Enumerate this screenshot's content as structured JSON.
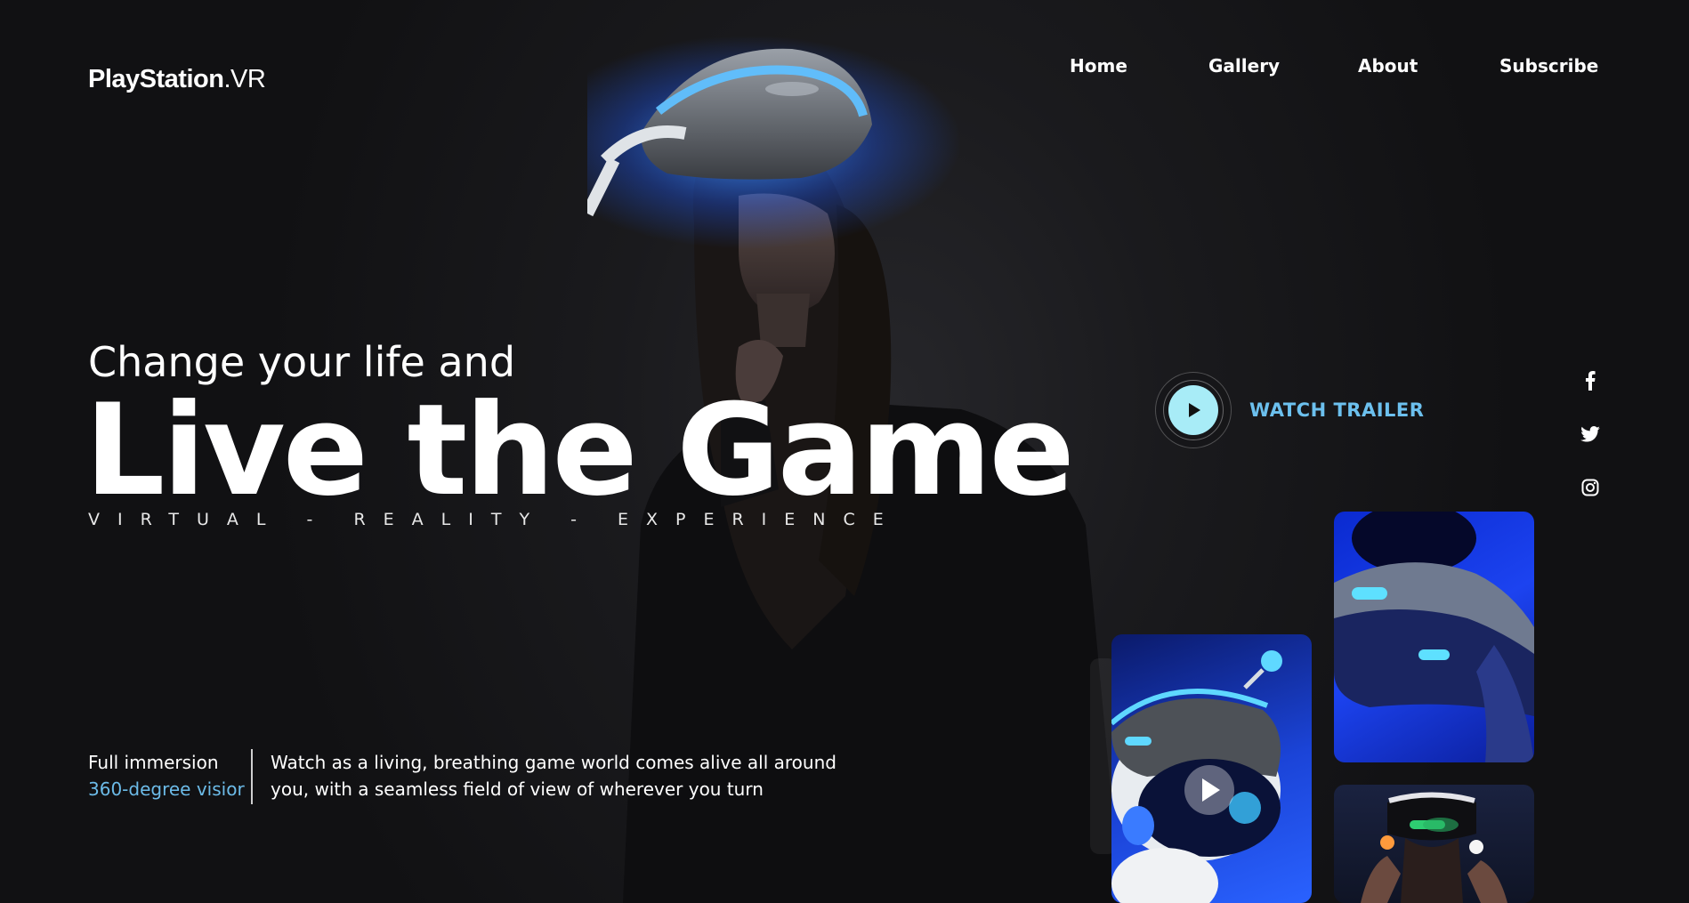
{
  "brand": {
    "name": "PlayStation",
    "suffix": ".VR"
  },
  "nav": [
    {
      "label": "Home"
    },
    {
      "label": "Gallery"
    },
    {
      "label": "About"
    },
    {
      "label": "Subscribe"
    }
  ],
  "hero": {
    "tagline": "Change your life and",
    "headline": "Live the Game",
    "subtitle": "VIRTUAL - REALITY - EXPERIENCE"
  },
  "trailer": {
    "label": "WATCH TRAILER",
    "icon": "play-icon"
  },
  "social": [
    {
      "icon": "facebook-icon"
    },
    {
      "icon": "twitter-icon"
    },
    {
      "icon": "instagram-icon"
    }
  ],
  "feature": {
    "label": "Full immersion",
    "sub": "360-degree visior",
    "description": "Watch as a living, breathing game world comes alive all around you, with a seamless field of view of wherever you turn"
  },
  "colors": {
    "accent": "#6cc0ee",
    "play_button": "#a8ecf7",
    "background": "#151517",
    "glow": "#3d8bff"
  }
}
